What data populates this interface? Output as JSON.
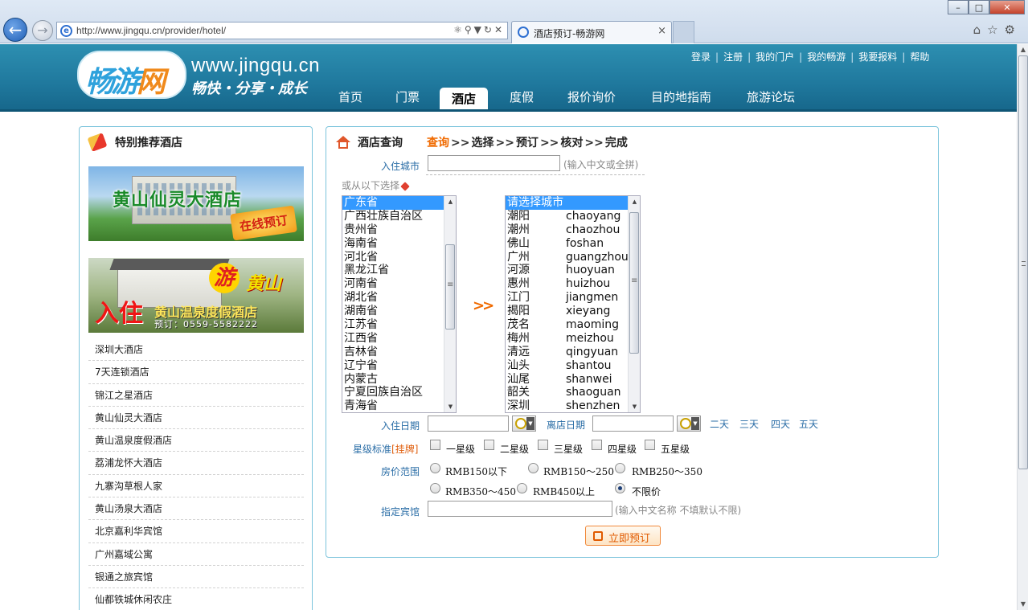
{
  "browser": {
    "url": "http://www.jingqu.cn/provider/hotel/",
    "tab_title": "酒店预订-畅游网",
    "back_icon": "back-arrow-icon",
    "forward_icon": "forward-arrow-icon"
  },
  "header": {
    "logo_text_1": "畅游",
    "logo_text_2": "网",
    "domain": "www.jingqu.cn",
    "slogan": "畅快・分享・成长",
    "top_links": [
      "登录",
      "注册",
      "我的门户",
      "我的畅游",
      "我要报料",
      "帮助"
    ],
    "nav": [
      "首页",
      "门票",
      "酒店",
      "度假",
      "报价询价",
      "目的地指南",
      "旅游论坛"
    ],
    "active_nav": "酒店"
  },
  "left": {
    "title": "特别推荐酒店",
    "banner1": {
      "title": "黄山仙灵大酒店",
      "badge": "在线预订"
    },
    "banner2": {
      "stamp": "游",
      "place": "黄山",
      "headline": "入住",
      "name": "黄山温泉度假酒店",
      "phone": "预订：0559-5582222"
    },
    "hotels": [
      "深圳大酒店",
      "7天连锁酒店",
      "锦江之星酒店",
      "黄山仙灵大酒店",
      "黄山温泉度假酒店",
      "荔浦龙怀大酒店",
      "九寨沟草根人家",
      "黄山汤泉大酒店",
      "北京嘉利华宾馆",
      "广州嘉域公寓",
      "银通之旅宾馆",
      "仙都铁城休闲农庄"
    ]
  },
  "search": {
    "title": "酒店查询",
    "steps": [
      "查询",
      "选择",
      "预订",
      "核对",
      "完成"
    ],
    "step_sep": ">>",
    "city_label": "入住城市",
    "city_value": "",
    "city_hint": "(输入中文或全拼)",
    "pick_label": "或从以下选择",
    "provinces": [
      "广东省",
      "广西壮族自治区",
      "贵州省",
      "海南省",
      "河北省",
      "黑龙江省",
      "河南省",
      "湖北省",
      "湖南省",
      "江苏省",
      "江西省",
      "吉林省",
      "辽宁省",
      "内蒙古",
      "宁夏回族自治区",
      "青海省"
    ],
    "selected_province": "广东省",
    "transfer": ">>",
    "city_placeholder_option": "请选择城市",
    "cities": [
      {
        "cn": "潮阳",
        "py": "chaoyang"
      },
      {
        "cn": "潮州",
        "py": "chaozhou"
      },
      {
        "cn": "佛山",
        "py": "foshan"
      },
      {
        "cn": "广州",
        "py": "guangzhou"
      },
      {
        "cn": "河源",
        "py": "huoyuan"
      },
      {
        "cn": "惠州",
        "py": "huizhou"
      },
      {
        "cn": "江门",
        "py": "jiangmen"
      },
      {
        "cn": "揭阳",
        "py": "xieyang"
      },
      {
        "cn": "茂名",
        "py": "maoming"
      },
      {
        "cn": "梅州",
        "py": "meizhou"
      },
      {
        "cn": "清远",
        "py": "qingyuan"
      },
      {
        "cn": "汕头",
        "py": "shantou"
      },
      {
        "cn": "汕尾",
        "py": "shanwei"
      },
      {
        "cn": "韶关",
        "py": "shaoguan"
      },
      {
        "cn": "深圳",
        "py": "shenzhen"
      }
    ],
    "checkin_label": "入住日期",
    "checkout_label": "离店日期",
    "checkin_value": "",
    "checkout_value": "",
    "quick_days": [
      "二天",
      "三天",
      "四天",
      "五天"
    ],
    "star_label": "星级标准",
    "star_link": "[挂牌]",
    "stars": [
      "一星级",
      "二星级",
      "三星级",
      "四星级",
      "五星级"
    ],
    "price_label": "房价范围",
    "prices": [
      "RMB150以下",
      "RMB150～250",
      "RMB250～350",
      "RMB350～450",
      "RMB450以上",
      "不限价"
    ],
    "price_selected": "不限价",
    "hotel_label": "指定宾馆",
    "hotel_value": "",
    "hotel_hint": "(输入中文名称 不填默认不限)",
    "book_button": "立即预订"
  }
}
